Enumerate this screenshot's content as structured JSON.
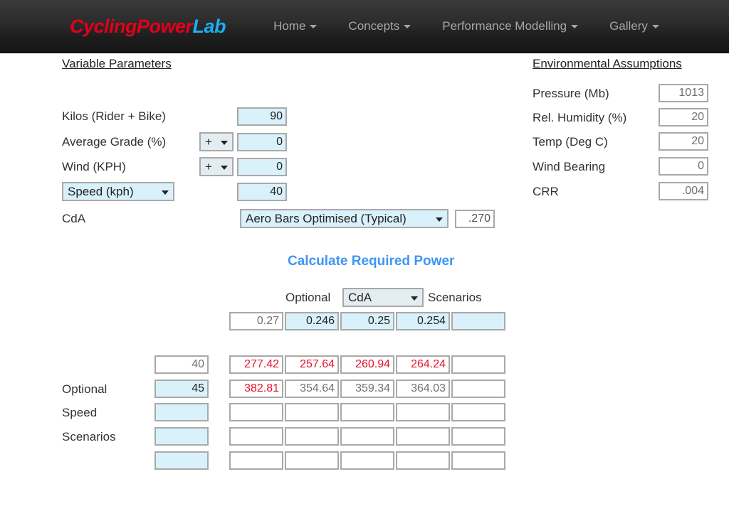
{
  "header": {
    "brand_part1": "CyclingPower",
    "brand_part2": "Lab",
    "nav": [
      {
        "label": "Home"
      },
      {
        "label": "Concepts"
      },
      {
        "label": "Performance Modelling"
      },
      {
        "label": "Gallery"
      }
    ]
  },
  "variable_parameters": {
    "title": "Variable Parameters",
    "kilos_label": "Kilos (Rider + Bike)",
    "kilos_value": "90",
    "grade_label": "Average Grade (%)",
    "grade_sign": "+",
    "grade_value": "0",
    "wind_label": "Wind (KPH)",
    "wind_sign": "+",
    "wind_value": "0",
    "speed_select": "Speed (kph)",
    "speed_value": "40",
    "cda_label": "CdA",
    "cda_select": "Aero Bars Optimised (Typical)",
    "cda_value": ".270"
  },
  "environmental_assumptions": {
    "title": "Environmental Assumptions",
    "rows": [
      {
        "label": "Pressure (Mb)",
        "value": "1013"
      },
      {
        "label": "Rel. Humidity (%)",
        "value": "20"
      },
      {
        "label": "Temp (Deg C)",
        "value": "20"
      },
      {
        "label": "Wind Bearing",
        "value": "0"
      },
      {
        "label": "CRR",
        "value": ".004"
      }
    ]
  },
  "calculate": {
    "button_label": "Calculate Required Power",
    "optional_label": "Optional",
    "scenario_variable": "CdA",
    "scenarios_label": "Scenarios",
    "scenario_values": [
      "0.27",
      "0.246",
      "0.25",
      "0.254",
      ""
    ]
  },
  "results": {
    "row_labels": [
      "",
      "Optional",
      "Speed",
      "Scenarios",
      ""
    ],
    "speeds": [
      "40",
      "45",
      "",
      "",
      ""
    ],
    "rows": [
      [
        "277.42",
        "257.64",
        "260.94",
        "264.24",
        ""
      ],
      [
        "382.81",
        "354.64",
        "359.34",
        "364.03",
        ""
      ],
      [
        "",
        "",
        "",
        "",
        ""
      ],
      [
        "",
        "",
        "",
        "",
        ""
      ],
      [
        "",
        "",
        "",
        "",
        ""
      ]
    ]
  },
  "colors": {
    "brand_red": "#e2001a",
    "brand_blue": "#1ab0f0",
    "link_blue": "#3d96f5",
    "value_red": "#e8112d",
    "value_grey": "#707070",
    "field_blue": "#d9f1fb"
  }
}
